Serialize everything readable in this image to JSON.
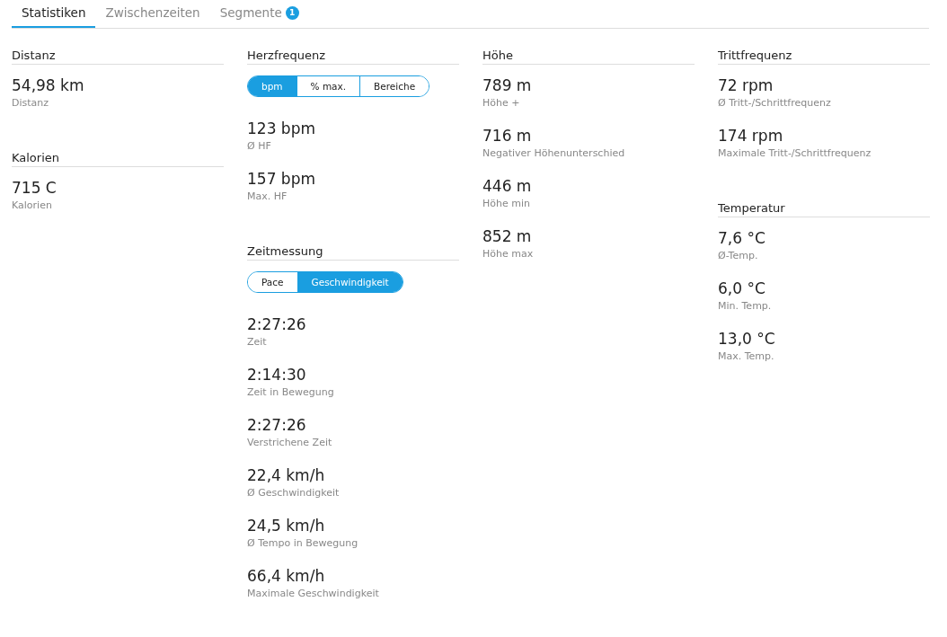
{
  "tabs": [
    {
      "label": "Statistiken",
      "selected": true
    },
    {
      "label": "Zwischenzeiten",
      "selected": false
    },
    {
      "label": "Segmente",
      "selected": false,
      "badge": "1"
    }
  ],
  "columns": [
    {
      "sections": [
        {
          "title": "Distanz",
          "stats": [
            {
              "value": "54,98 km",
              "label": "Distanz"
            }
          ]
        },
        {
          "title": "Kalorien",
          "stats": [
            {
              "value": "715 C",
              "label": "Kalorien"
            }
          ]
        }
      ]
    },
    {
      "sections": [
        {
          "title": "Herzfrequenz",
          "toggle": [
            {
              "label": "bpm",
              "selected": true
            },
            {
              "label": "% max.",
              "selected": false
            },
            {
              "label": "Bereiche",
              "selected": false
            }
          ],
          "stats": [
            {
              "value": "123 bpm",
              "label": "Ø HF"
            },
            {
              "value": "157 bpm",
              "label": "Max. HF"
            }
          ]
        },
        {
          "title": "Zeitmessung",
          "toggle": [
            {
              "label": "Pace",
              "selected": false
            },
            {
              "label": "Geschwindigkeit",
              "selected": true
            }
          ],
          "stats": [
            {
              "value": "2:27:26",
              "label": "Zeit"
            },
            {
              "value": "2:14:30",
              "label": "Zeit in Bewegung"
            },
            {
              "value": "2:27:26",
              "label": "Verstrichene Zeit"
            },
            {
              "value": "22,4 km/h",
              "label": "Ø Geschwindigkeit"
            },
            {
              "value": "24,5 km/h",
              "label": "Ø Tempo in Bewegung"
            },
            {
              "value": "66,4 km/h",
              "label": "Maximale Geschwindigkeit"
            }
          ]
        }
      ]
    },
    {
      "sections": [
        {
          "title": "Höhe",
          "stats": [
            {
              "value": "789 m",
              "label": "Höhe +"
            },
            {
              "value": "716 m",
              "label": "Negativer Höhenunterschied"
            },
            {
              "value": "446 m",
              "label": "Höhe min"
            },
            {
              "value": "852 m",
              "label": "Höhe max"
            }
          ]
        }
      ]
    },
    {
      "sections": [
        {
          "title": "Trittfrequenz",
          "stats": [
            {
              "value": "72 rpm",
              "label": "Ø Tritt-/Schrittfrequenz"
            },
            {
              "value": "174 rpm",
              "label": "Maximale Tritt-/Schrittfrequenz"
            }
          ]
        },
        {
          "title": "Temperatur",
          "stats": [
            {
              "value": "7,6 °C",
              "label": "Ø-Temp."
            },
            {
              "value": "6,0 °C",
              "label": "Min. Temp."
            },
            {
              "value": "13,0 °C",
              "label": "Max. Temp."
            }
          ]
        }
      ]
    }
  ]
}
